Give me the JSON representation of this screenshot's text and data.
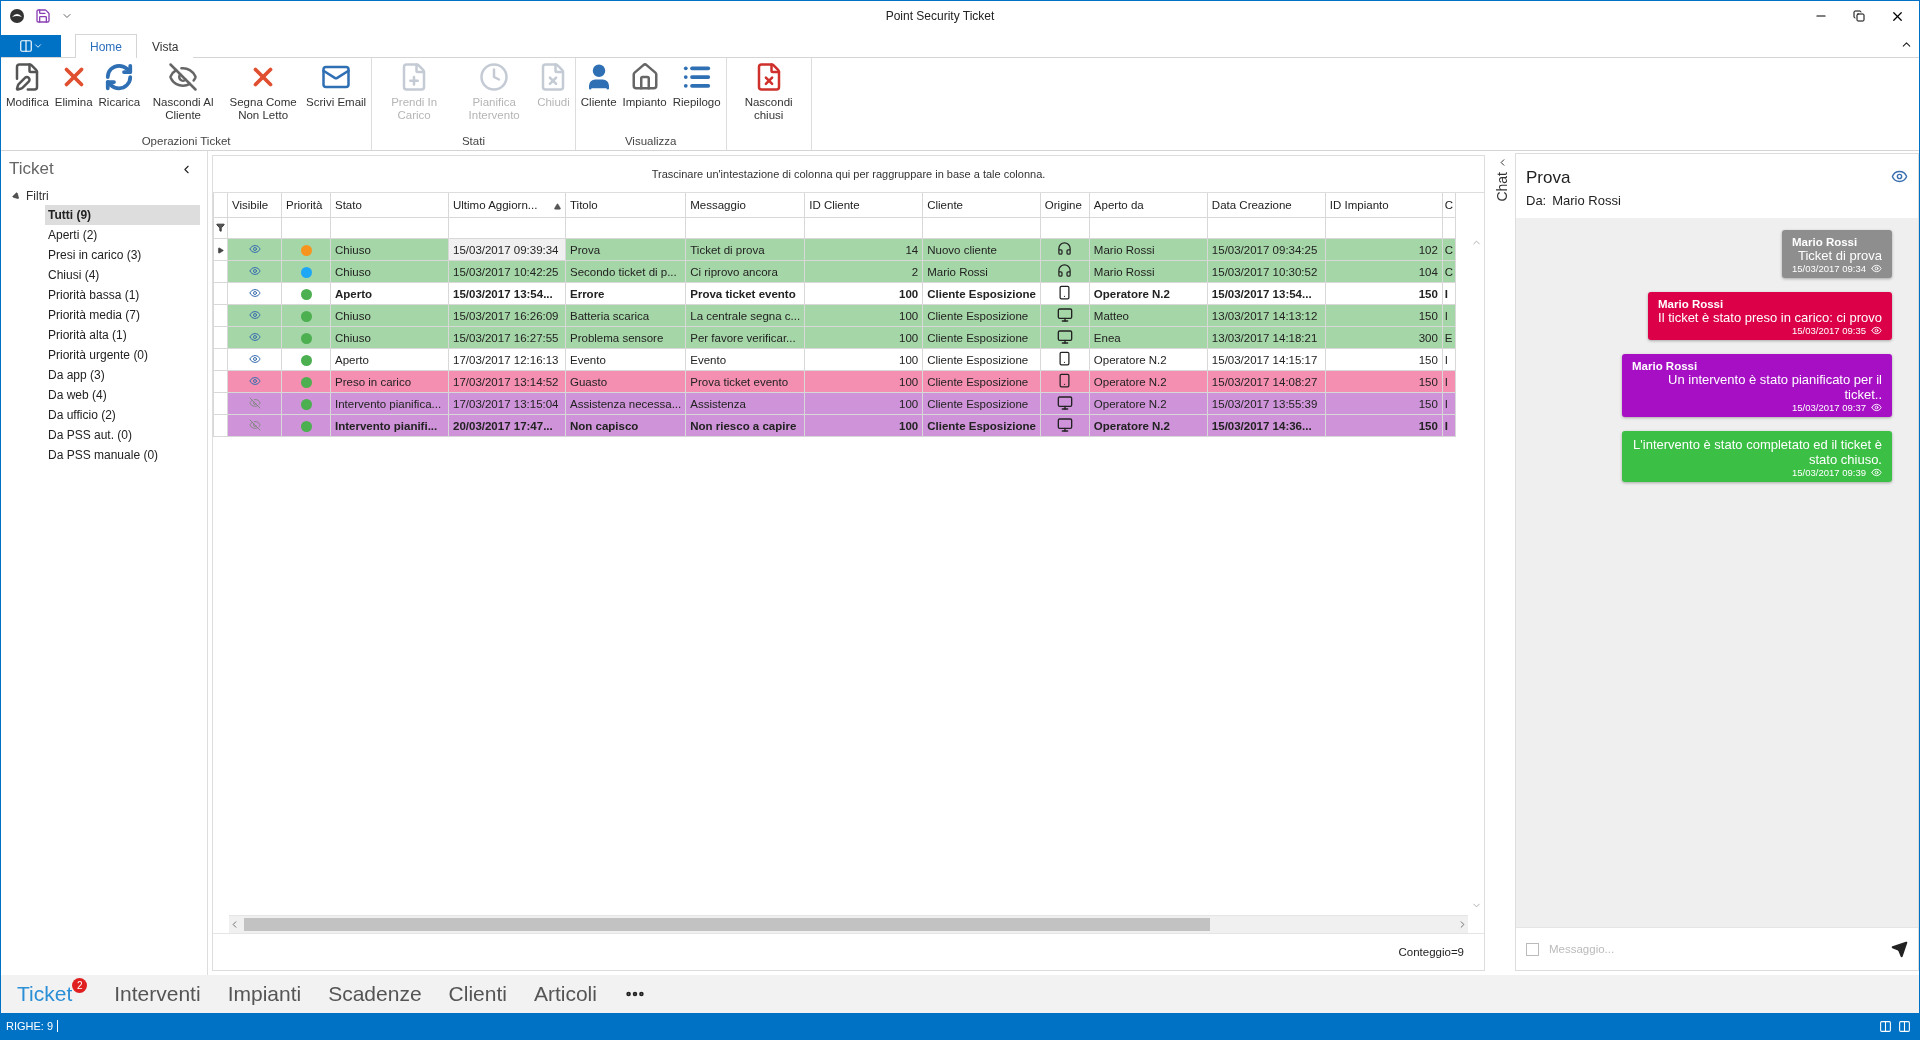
{
  "window": {
    "title": "Point Security Ticket"
  },
  "ribbon_tabs": [
    {
      "label": "Home",
      "selected": true
    },
    {
      "label": "Vista",
      "selected": false
    }
  ],
  "ribbon_groups": [
    {
      "label": "Operazioni Ticket",
      "buttons": [
        {
          "label": "Modifica",
          "kind": "edit",
          "disabled": false
        },
        {
          "label": "Elimina",
          "kind": "delete",
          "disabled": false
        },
        {
          "label": "Ricarica",
          "kind": "reload",
          "disabled": false
        },
        {
          "label": "Nascondi Al Cliente",
          "kind": "hide",
          "disabled": false
        },
        {
          "label": "Segna Come Non Letto",
          "kind": "delete",
          "disabled": false
        },
        {
          "label": "Scrivi Email",
          "kind": "mail",
          "disabled": false
        }
      ]
    },
    {
      "label": "Stati",
      "buttons": [
        {
          "label": "Prendi In Carico",
          "kind": "take",
          "disabled": true
        },
        {
          "label": "Pianifica Intervento",
          "kind": "clock",
          "disabled": true
        },
        {
          "label": "Chiudi",
          "kind": "close",
          "disabled": true
        }
      ]
    },
    {
      "label": "Visualizza",
      "buttons": [
        {
          "label": "Cliente",
          "kind": "user",
          "disabled": false
        },
        {
          "label": "Impianto",
          "kind": "house",
          "disabled": false
        },
        {
          "label": "Riepilogo",
          "kind": "list",
          "disabled": false
        }
      ]
    },
    {
      "buttons": [
        {
          "label": "Nascondi chiusi",
          "kind": "close",
          "disabled": false
        }
      ]
    }
  ],
  "sidebar": {
    "title": "Ticket",
    "tree": {
      "label": "Filtri",
      "expanded": true,
      "children": [
        {
          "label": "Tutti (9)",
          "selected": true
        },
        {
          "label": "Aperti (2)",
          "selected": false
        },
        {
          "label": "Presi in carico (3)",
          "selected": false
        },
        {
          "label": "Chiusi (4)",
          "selected": false
        },
        {
          "label": "Priorità bassa (1)",
          "selected": false
        },
        {
          "label": "Priorità media (7)",
          "selected": false
        },
        {
          "label": "Priorità alta (1)",
          "selected": false
        },
        {
          "label": "Priorità urgente (0)",
          "selected": false
        },
        {
          "label": "Da app (3)",
          "selected": false
        },
        {
          "label": "Da web (4)",
          "selected": false
        },
        {
          "label": "Da ufficio (2)",
          "selected": false
        },
        {
          "label": "Da PSS aut. (0)",
          "selected": false
        },
        {
          "label": "Da PSS manuale (0)",
          "selected": false
        }
      ]
    }
  },
  "table": {
    "group_hint": "Trascinare un'intestazione di colonna qui per raggruppare in base a tale colonna.",
    "columns": [
      {
        "label": "Visibile",
        "sorted": false
      },
      {
        "label": "Priorità",
        "sorted": false
      },
      {
        "label": "Stato",
        "sorted": false
      },
      {
        "label": "Ultimo Aggiorn...",
        "sorted": true
      },
      {
        "label": "Titolo",
        "sorted": false
      },
      {
        "label": "Messaggio",
        "sorted": false
      },
      {
        "label": "ID Cliente",
        "sorted": false
      },
      {
        "label": "Cliente",
        "sorted": false
      },
      {
        "label": "Origine",
        "sorted": false
      },
      {
        "label": "Aperto da",
        "sorted": false
      },
      {
        "label": "Data Creazione",
        "sorted": false
      },
      {
        "label": "ID Impianto",
        "sorted": false
      },
      {
        "label": "C",
        "sorted": false
      }
    ],
    "rows": [
      {
        "selected": true,
        "color": "#a5d6a7",
        "unread": false,
        "cells": [
          {
            "visible": true
          },
          {
            "color": "#f7941d"
          },
          "Chiuso",
          "15/03/2017 09:39:34",
          "Prova",
          "Ticket di prova",
          "14",
          "Nuovo cliente",
          {
            "kind": "headset"
          },
          "Mario Rossi",
          "15/03/2017 09:34:25",
          "102",
          "C"
        ]
      },
      {
        "selected": false,
        "color": "#a5d6a7",
        "unread": false,
        "cells": [
          {
            "visible": true
          },
          {
            "color": "#1ea7f5"
          },
          "Chiuso",
          "15/03/2017 10:42:25",
          "Secondo ticket di p...",
          "Ci riprovo ancora",
          "2",
          "Mario Rossi",
          {
            "kind": "headset"
          },
          "Mario Rossi",
          "15/03/2017 10:30:52",
          "104",
          "C"
        ]
      },
      {
        "selected": false,
        "color": "#ffffff",
        "unread": true,
        "cells": [
          {
            "visible": true
          },
          {
            "color": "#4caf50"
          },
          "Aperto",
          "15/03/2017 13:54...",
          "Errore",
          "Prova ticket evento",
          "100",
          "Cliente Esposizione",
          {
            "kind": "phone"
          },
          "Operatore N.2",
          "15/03/2017 13:54...",
          "150",
          "I"
        ]
      },
      {
        "selected": false,
        "color": "#a5d6a7",
        "unread": false,
        "cells": [
          {
            "visible": true
          },
          {
            "color": "#4caf50"
          },
          "Chiuso",
          "15/03/2017 16:26:09",
          "Batteria scarica",
          "La centrale segna c...",
          "100",
          "Cliente Esposizione",
          {
            "kind": "monitor"
          },
          "Matteo",
          "13/03/2017 14:13:12",
          "150",
          "I"
        ]
      },
      {
        "selected": false,
        "color": "#a5d6a7",
        "unread": false,
        "cells": [
          {
            "visible": true
          },
          {
            "color": "#4caf50"
          },
          "Chiuso",
          "15/03/2017 16:27:55",
          "Problema sensore",
          "Per favore verificar...",
          "100",
          "Cliente Esposizione",
          {
            "kind": "monitor"
          },
          "Enea",
          "13/03/2017 14:18:21",
          "300",
          "E"
        ]
      },
      {
        "selected": false,
        "color": "#ffffff",
        "unread": false,
        "cells": [
          {
            "visible": true
          },
          {
            "color": "#4caf50"
          },
          "Aperto",
          "17/03/2017 12:16:13",
          "Evento",
          "Evento",
          "100",
          "Cliente Esposizione",
          {
            "kind": "phone"
          },
          "Operatore N.2",
          "15/03/2017 14:15:17",
          "150",
          "I"
        ]
      },
      {
        "selected": false,
        "color": "#f48fb1",
        "unread": false,
        "cells": [
          {
            "visible": true
          },
          {
            "color": "#4caf50"
          },
          "Preso in carico",
          "17/03/2017 13:14:52",
          "Guasto",
          "Prova ticket evento",
          "100",
          "Cliente Esposizione",
          {
            "kind": "phone"
          },
          "Operatore N.2",
          "15/03/2017 14:08:27",
          "150",
          "I"
        ]
      },
      {
        "selected": false,
        "color": "#ce93d8",
        "unread": false,
        "cells": [
          {
            "visible": false
          },
          {
            "color": "#4caf50"
          },
          "Intervento pianifica...",
          "17/03/2017 13:15:04",
          "Assistenza necessa...",
          "Assistenza",
          "100",
          "Cliente Esposizione",
          {
            "kind": "monitor"
          },
          "Operatore N.2",
          "15/03/2017 13:55:39",
          "150",
          "I"
        ]
      },
      {
        "selected": false,
        "color": "#ce93d8",
        "unread": true,
        "cells": [
          {
            "visible": false
          },
          {
            "color": "#4caf50"
          },
          "Intervento pianifi...",
          "20/03/2017 17:47...",
          "Non capisco",
          "Non riesco a capire",
          "100",
          "Cliente Esposizione",
          {
            "kind": "monitor"
          },
          "Operatore N.2",
          "15/03/2017 14:36...",
          "150",
          "I"
        ]
      }
    ],
    "footer": "Conteggio=9"
  },
  "chat": {
    "strip_label": "Chat",
    "title": "Prova",
    "from_label": "Da:",
    "from": "Mario Rossi",
    "messages": [
      {
        "author": "Mario Rossi",
        "text": "Ticket di prova",
        "time": "15/03/2017 09:34",
        "color": "#8e8e8e"
      },
      {
        "author": "Mario Rossi",
        "text": "Il ticket è stato preso in carico: ci provo",
        "time": "15/03/2017 09:35",
        "color": "#dc0049"
      },
      {
        "author": "Mario Rossi",
        "text": "Un intervento è stato pianificato per il ticket..",
        "time": "15/03/2017 09:37",
        "color": "#a60fc4"
      },
      {
        "text": "L'intervento è stato completato ed il ticket è stato chiuso.",
        "time": "15/03/2017 09:39",
        "color": "#3cbf45"
      }
    ],
    "input": {
      "placeholder": "Messaggio...",
      "checked": false
    }
  },
  "bottom_tabs": [
    {
      "label": "Ticket",
      "selected": true,
      "badge": "2"
    },
    {
      "label": "Interventi",
      "selected": false
    },
    {
      "label": "Impianti",
      "selected": false
    },
    {
      "label": "Scadenze",
      "selected": false
    },
    {
      "label": "Clienti",
      "selected": false
    },
    {
      "label": "Articoli",
      "selected": false
    }
  ],
  "status_bar": {
    "text": "RIGHE: 9"
  }
}
